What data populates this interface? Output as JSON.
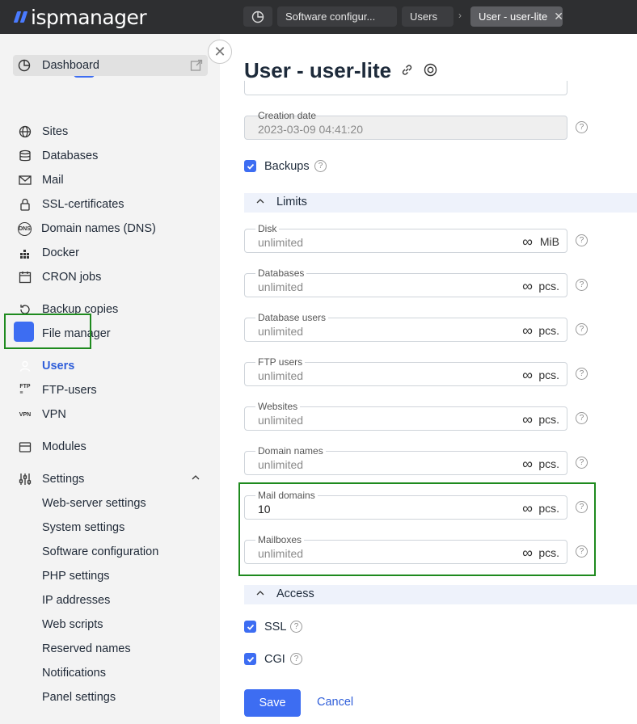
{
  "app": {
    "logo_text": "ispmanager"
  },
  "tabs": [
    {
      "label": "Software configur..."
    },
    {
      "label": "Users"
    },
    {
      "label": "User - user-lite"
    }
  ],
  "breadcrumb_sep": "›",
  "sidebar": {
    "dashboard": "Dashboard",
    "items": [
      {
        "label": "Sites"
      },
      {
        "label": "Databases"
      },
      {
        "label": "Mail"
      },
      {
        "label": "SSL-certificates"
      },
      {
        "label": "Domain names (DNS)"
      },
      {
        "label": "Docker"
      },
      {
        "label": "CRON jobs"
      },
      {
        "label": "Backup copies"
      },
      {
        "label": "File manager"
      },
      {
        "label": "Users"
      },
      {
        "label": "FTP-users"
      },
      {
        "label": "VPN"
      },
      {
        "label": "Modules"
      },
      {
        "label": "Settings"
      }
    ],
    "settings_sub": [
      {
        "label": "Web-server settings"
      },
      {
        "label": "System settings"
      },
      {
        "label": "Software configuration"
      },
      {
        "label": "PHP settings"
      },
      {
        "label": "IP addresses"
      },
      {
        "label": "Web scripts"
      },
      {
        "label": "Reserved names"
      },
      {
        "label": "Notifications"
      },
      {
        "label": "Panel settings"
      }
    ]
  },
  "page": {
    "title": "User - user-lite"
  },
  "creation_date": {
    "label": "Creation date",
    "value": "2023-03-09 04:41:20"
  },
  "backups": {
    "label": "Backups",
    "checked": true
  },
  "limits": {
    "title": "Limits",
    "fields": [
      {
        "label": "Disk",
        "value": "unlimited",
        "unit": "MiB"
      },
      {
        "label": "Databases",
        "value": "unlimited",
        "unit": "pcs."
      },
      {
        "label": "Database users",
        "value": "unlimited",
        "unit": "pcs."
      },
      {
        "label": "FTP users",
        "value": "unlimited",
        "unit": "pcs."
      },
      {
        "label": "Websites",
        "value": "unlimited",
        "unit": "pcs."
      },
      {
        "label": "Domain names",
        "value": "unlimited",
        "unit": "pcs."
      },
      {
        "label": "Mail domains",
        "value": "10",
        "unit": "pcs."
      },
      {
        "label": "Mailboxes",
        "value": "unlimited",
        "unit": "pcs."
      }
    ]
  },
  "access": {
    "title": "Access",
    "ssl": {
      "label": "SSL",
      "checked": true
    },
    "cgi": {
      "label": "CGI",
      "checked": true
    }
  },
  "actions": {
    "save": "Save",
    "cancel": "Cancel"
  },
  "help_glyph": "?",
  "inf_glyph": "∞",
  "colors": {
    "accent": "#3d6df2",
    "topbar": "#2e2f31",
    "highlight": "#1e8a1e"
  }
}
